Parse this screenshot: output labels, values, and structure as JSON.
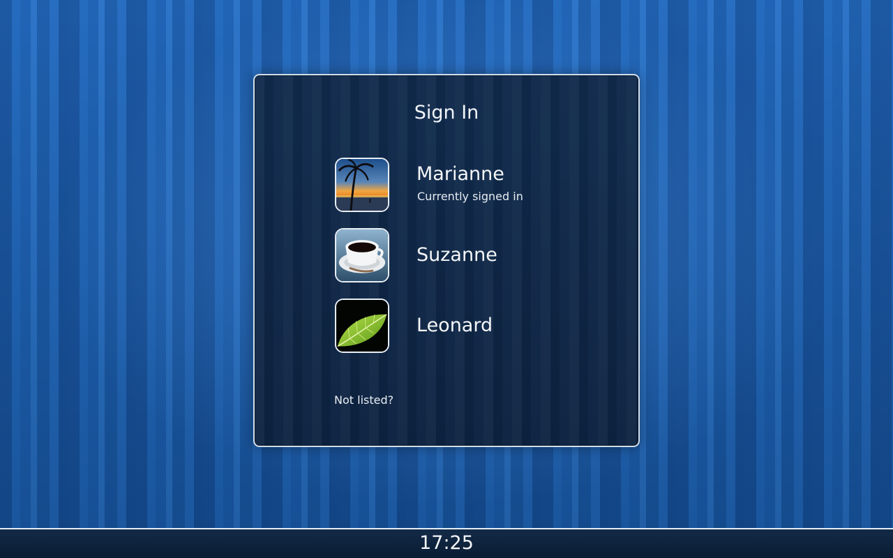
{
  "sign_in_panel": {
    "title": "Sign In",
    "users": [
      {
        "name": "Marianne",
        "status": "Currently signed in",
        "avatar_icon": "palm-tree-sunset-icon"
      },
      {
        "name": "Suzanne",
        "status": "",
        "avatar_icon": "coffee-cup-icon"
      },
      {
        "name": "Leonard",
        "status": "",
        "avatar_icon": "green-leaf-icon"
      }
    ],
    "not_listed_label": "Not listed?"
  },
  "taskbar": {
    "clock": "17:25"
  },
  "colors": {
    "wallpaper_blue": "#1a5cab",
    "panel_dark_navy": "#0e2544",
    "border_white": "#e7eef5"
  }
}
